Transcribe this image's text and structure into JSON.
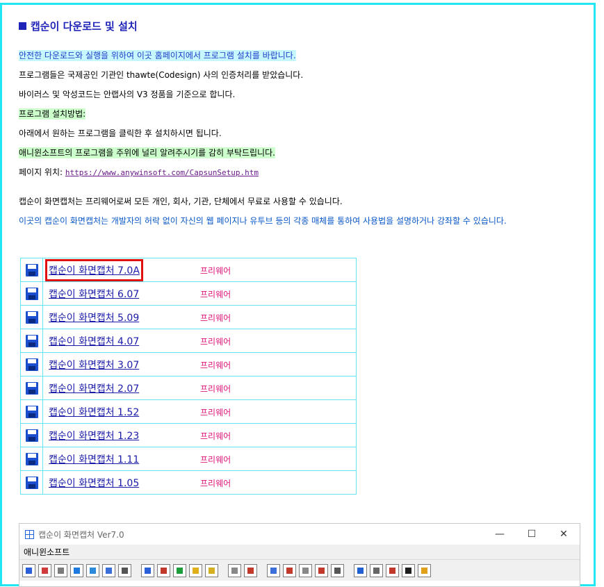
{
  "heading": "캡순이 다운로드 및 설치",
  "lines": {
    "l1": "안전한 다운로드와 실행을 위하여 이곳 홈페이지에서 프로그램 설치를 바랍니다.",
    "l2": "프로그램들은 국제공인 기관인 thawte(Codesign) 사의 인증처리를 받았습니다.",
    "l3": "바이러스 및 악성코드는 안랩사의 V3 정품을 기준으로 합니다.",
    "l4": "프로그램 설치방법:",
    "l5": "아래에서 원하는 프로그램을 클릭한 후 설치하시면 됩니다.",
    "l6": "애니윈소프트의 프로그램을 주위에 널리 알려주시기를 감히 부탁드립니다.",
    "l7_prefix": "페이지 위치: ",
    "l7_url": "https://www.anywinsoft.com/CapsunSetup.htm",
    "l8": "캡순이 화면캡처는 프리웨어로써 모든 개인, 회사, 기관, 단체에서 무료로 사용할 수 있습니다.",
    "l9": "이곳의 캡순이 화면캡처는 개발자의 허락 없이 자신의 웹 페이지나 유투브 등의 각종 매체를 통하여 사용법을 설명하거나 강좌할 수 있습니다."
  },
  "downloads": [
    {
      "name": "캡순이 화면캡처 7.0A",
      "license": "프리웨어"
    },
    {
      "name": "캡순이 화면캡처 6.07",
      "license": "프리웨어"
    },
    {
      "name": "캡순이 화면캡처 5.09",
      "license": "프리웨어"
    },
    {
      "name": "캡순이 화면캡처 4.07",
      "license": "프리웨어"
    },
    {
      "name": "캡순이 화면캡처 3.07",
      "license": "프리웨어"
    },
    {
      "name": "캡순이 화면캡처 2.07",
      "license": "프리웨어"
    },
    {
      "name": "캡순이 화면캡처 1.52",
      "license": "프리웨어"
    },
    {
      "name": "캡순이 화면캡처 1.23",
      "license": "프리웨어"
    },
    {
      "name": "캡순이 화면캡처 1.11",
      "license": "프리웨어"
    },
    {
      "name": "캡순이 화면캡처 1.05",
      "license": "프리웨어"
    }
  ],
  "app": {
    "title": "캡순이 화면캡처 Ver7.0",
    "menu": "애니윈소프트",
    "controls": {
      "minimize": "—",
      "maximize": "☐",
      "close": "✕"
    }
  },
  "colors": {
    "frame": "#22e6f2",
    "heading": "#1f24b8",
    "highlight_box": "#e01010",
    "freeware": "#e0147a"
  }
}
